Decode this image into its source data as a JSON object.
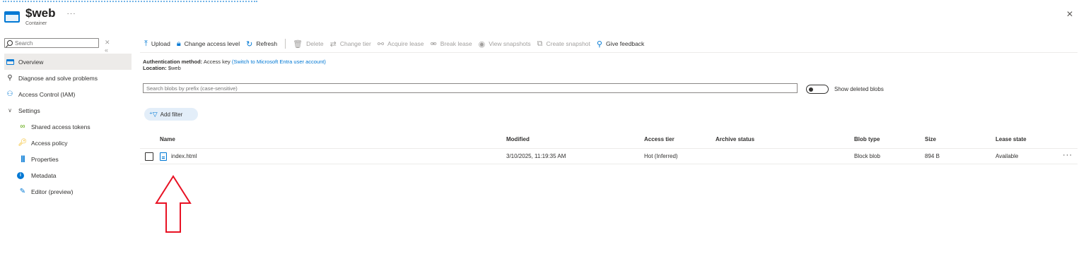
{
  "header": {
    "title": "$web",
    "subtitle": "Container",
    "more": "···",
    "close": "✕"
  },
  "sidebar": {
    "search_placeholder": "Search",
    "clear": "✕",
    "collapse": "«",
    "items": [
      {
        "label": "Overview",
        "icon": "overview-icon",
        "active": true
      },
      {
        "label": "Diagnose and solve problems",
        "icon": "wrench-icon"
      },
      {
        "label": "Access Control (IAM)",
        "icon": "people-icon"
      },
      {
        "label": "Settings",
        "icon": "chevron-down-icon"
      },
      {
        "label": "Shared access tokens",
        "icon": "link-icon"
      },
      {
        "label": "Access policy",
        "icon": "key-icon"
      },
      {
        "label": "Properties",
        "icon": "properties-icon"
      },
      {
        "label": "Metadata",
        "icon": "info-icon"
      },
      {
        "label": "Editor (preview)",
        "icon": "pencil-icon"
      }
    ]
  },
  "toolbar": {
    "upload": "Upload",
    "change_access_level": "Change access level",
    "refresh": "Refresh",
    "delete": "Delete",
    "change_tier": "Change tier",
    "acquire_lease": "Acquire lease",
    "break_lease": "Break lease",
    "view_snapshots": "View snapshots",
    "create_snapshot": "Create snapshot",
    "give_feedback": "Give feedback"
  },
  "info": {
    "auth_label": "Authentication method:",
    "auth_value": "Access key",
    "auth_link": "(Switch to Microsoft Entra user account)",
    "location_label": "Location:",
    "location_value": "$web"
  },
  "filters": {
    "blob_search_placeholder": "Search blobs by prefix (case-sensitive)",
    "show_deleted_label": "Show deleted blobs",
    "show_deleted_on": false,
    "add_filter": "Add filter"
  },
  "table": {
    "columns": [
      "Name",
      "Modified",
      "Access tier",
      "Archive status",
      "Blob type",
      "Size",
      "Lease state"
    ],
    "rows": [
      {
        "name": "index.html",
        "modified": "3/10/2025, 11:19:35 AM",
        "access_tier": "Hot (Inferred)",
        "archive_status": "",
        "blob_type": "Block blob",
        "size": "894 B",
        "lease_state": "Available",
        "more": "···"
      }
    ]
  },
  "colors": {
    "accent": "#0078d4",
    "annotation_arrow": "#e81123"
  }
}
